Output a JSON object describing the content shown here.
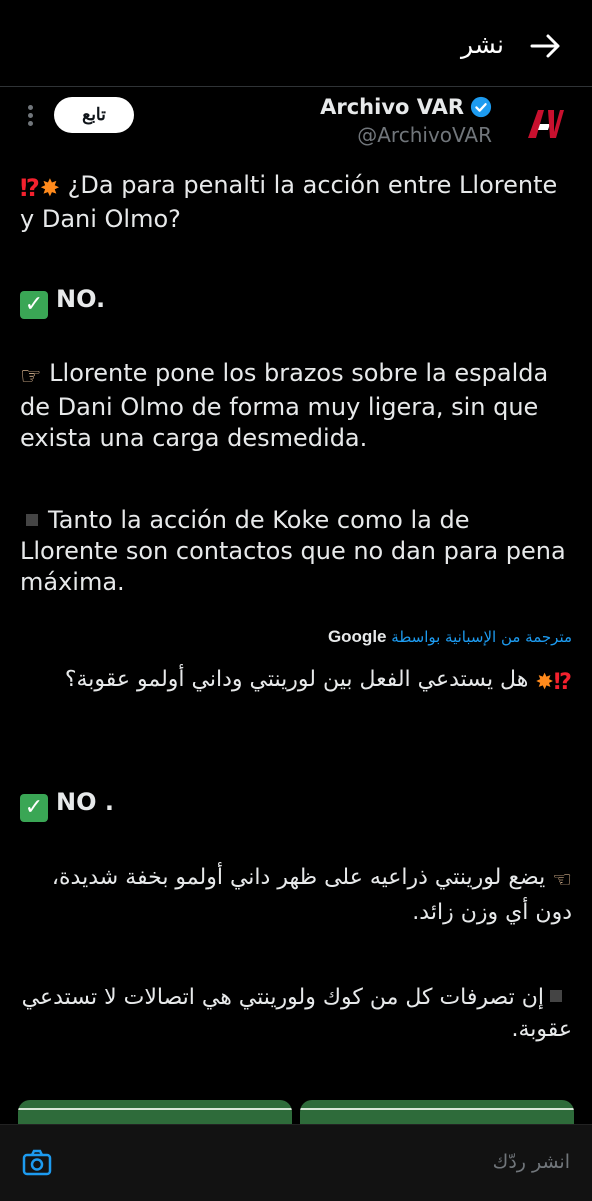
{
  "header": {
    "title": "نشر"
  },
  "tweet": {
    "author_name": "Archivo VAR",
    "author_handle": "@ArchivoVAR",
    "follow_label": "تابع",
    "original": {
      "line1": "¿Da para penalti la acción entre Llorente y Dani Olmo?",
      "line2": "NO.",
      "line3": "Llorente pone los brazos sobre la espalda de Dani Olmo de forma muy ligera, sin que exista una carga desmedida.",
      "line4": "Tanto la acción de Koke como la de Llorente son contactos que no dan para pena máxima."
    },
    "translation_label": "مترجمة من الإسبانية بواسطة",
    "translation_provider": "Google",
    "translated": {
      "line1": "هل يستدعي الفعل بين لورينتي وداني أولمو عقوبة؟",
      "line2": "NO .",
      "line3": "يضع لورينتي ذراعيه على ظهر داني أولمو بخفة شديدة، دون أي وزن زائد.",
      "line4": "إن تصرفات كل من كوك ولورينتي هي اتصالات لا تستدعي عقوبة."
    }
  },
  "reply_bar": {
    "placeholder": "انشر ردّك"
  },
  "colors": {
    "background": "#000000",
    "accent": "#1d9bf0",
    "text": "#e7e9ea",
    "muted": "#71767b",
    "avatar_red": "#c8102e"
  },
  "icons": [
    "back-arrow-icon",
    "verified-badge-icon",
    "more-vertical-icon",
    "camera-icon",
    "avatar-logo"
  ]
}
